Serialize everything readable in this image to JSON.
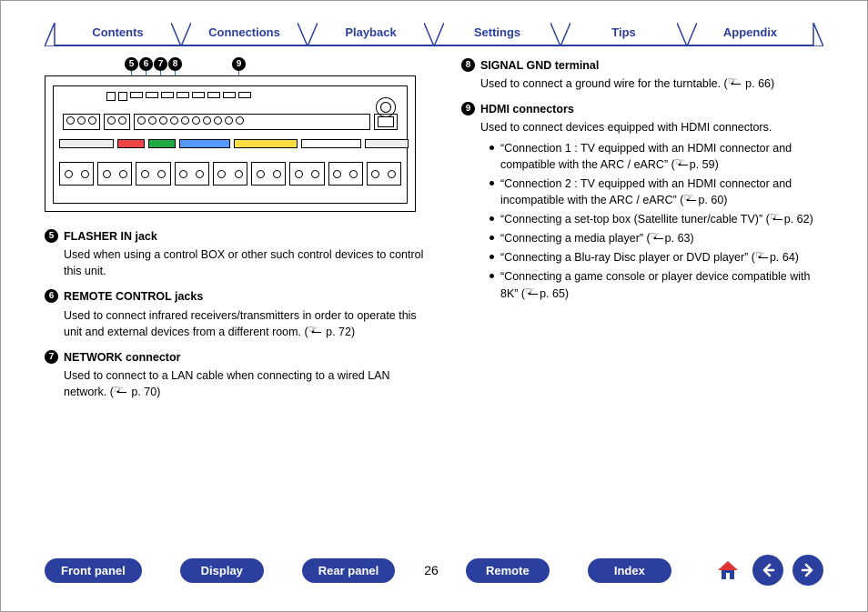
{
  "topnav": {
    "tabs": [
      "Contents",
      "Connections",
      "Playback",
      "Settings",
      "Tips",
      "Appendix"
    ]
  },
  "callout_labels": [
    "5",
    "6",
    "7",
    "8",
    "9"
  ],
  "left_defs": [
    {
      "num": "5",
      "title": "FLASHER IN jack",
      "desc": "Used when using a control BOX or other such control devices to control this unit."
    },
    {
      "num": "6",
      "title": "REMOTE CONTROL jacks",
      "desc": "Used to connect infrared receivers/transmitters in order to operate this unit and external devices from a different room.  (",
      "page": "p. 72",
      "tail": ")"
    },
    {
      "num": "7",
      "title": "NETWORK connector",
      "desc": "Used to connect to a LAN cable when connecting to a wired LAN network.  (",
      "page": "p. 70",
      "tail": ")"
    }
  ],
  "right_defs": [
    {
      "num": "8",
      "title": "SIGNAL GND terminal",
      "desc": "Used to connect a ground wire for the turntable.  (",
      "page": "p. 66",
      "tail": ")"
    },
    {
      "num": "9",
      "title": "HDMI connectors",
      "desc": "Used to connect devices equipped with HDMI connectors.",
      "bullets": [
        {
          "text_a": "“Connection 1 : TV equipped with an HDMI connector and compatible with the ARC / eARC” (",
          "page": "p. 59",
          "text_b": ")"
        },
        {
          "text_a": "“Connection 2 : TV equipped with an HDMI connector and incompatible with the ARC / eARC” (",
          "page": "p. 60",
          "text_b": ")"
        },
        {
          "text_a": "“Connecting a set-top box (Satellite tuner/cable TV)” (",
          "page": "p. 62",
          "text_b": ")"
        },
        {
          "text_a": "“Connecting a media player” (",
          "page": "p. 63",
          "text_b": ")"
        },
        {
          "text_a": "“Connecting a Blu-ray Disc player or DVD player” (",
          "page": "p. 64",
          "text_b": ")"
        },
        {
          "text_a": "“Connecting a game console or player device compatible with 8K” (",
          "page": "p. 65",
          "text_b": ")"
        }
      ]
    }
  ],
  "page_number": "26",
  "bottomnav": {
    "pills": [
      "Front panel",
      "Display",
      "Rear panel"
    ],
    "pills_right": [
      "Remote",
      "Index"
    ]
  }
}
